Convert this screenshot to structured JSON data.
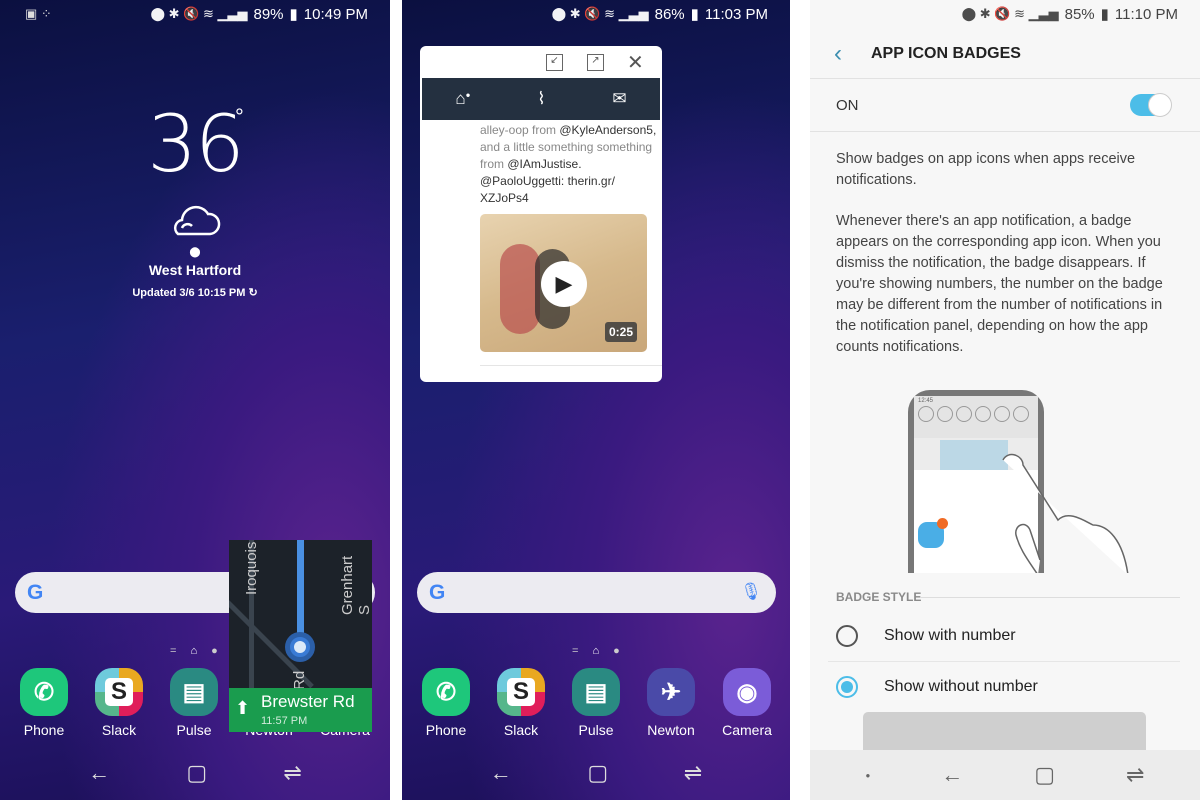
{
  "left": {
    "status": {
      "battery": "89%",
      "time": "10:49 PM"
    },
    "weather": {
      "temp": "36",
      "degree": "°",
      "location": "West Hartford",
      "updated": "Updated 3/6 10:15 PM",
      "icon": "cloud-icon"
    },
    "map_widget": {
      "street_labels": [
        "Iroquois",
        "Grenhart S",
        "Rd",
        "d"
      ],
      "next_street": "Brewster Rd",
      "eta": "11:57 PM"
    },
    "dock": [
      {
        "label": "Phone",
        "color": "#1ec77b"
      },
      {
        "label": "Slack",
        "color": "#ffffff"
      },
      {
        "label": "Pulse",
        "color": "#2a8a82"
      },
      {
        "label": "Newton",
        "color": "#4a4aa8"
      },
      {
        "label": "Camera",
        "color": "#7b5cd8"
      }
    ]
  },
  "middle": {
    "status": {
      "battery": "86%",
      "time": "11:03 PM"
    },
    "popup": {
      "tweet_lines": [
        {
          "gray": "alley-oop from ",
          "dark": "@KyleAnderson5,"
        },
        {
          "gray": "and a little something something",
          "dark": ""
        },
        {
          "gray": "from ",
          "dark": "@IAmJustise."
        },
        {
          "gray": "",
          "dark": "@PaoloUggetti: therin.gr/"
        },
        {
          "gray": "",
          "dark": "XZJoPs4"
        }
      ],
      "video_duration": "0:25"
    },
    "dock": [
      {
        "label": "Phone",
        "color": "#1ec77b"
      },
      {
        "label": "Slack",
        "color": "#ffffff"
      },
      {
        "label": "Pulse",
        "color": "#2a8a82"
      },
      {
        "label": "Newton",
        "color": "#4a4aa8"
      },
      {
        "label": "Camera",
        "color": "#7b5cd8"
      }
    ]
  },
  "right": {
    "status": {
      "battery": "85%",
      "time": "11:10 PM"
    },
    "title": "APP ICON BADGES",
    "toggle": {
      "label": "ON",
      "on": true,
      "accent": "#4cbde8"
    },
    "desc1": "Show badges on app icons when apps receive notifications.",
    "desc2": "Whenever there's an app notification, a badge appears on the corresponding app icon. When you dismiss the notification, the badge disappears. If you're showing numbers, the number on the badge may be different from the number of notifications in the notification panel, depending on how the app counts notifications.",
    "illustration_time": "12:45",
    "section": "BADGE STYLE",
    "options": [
      {
        "label": "Show with number",
        "selected": false
      },
      {
        "label": "Show without number",
        "selected": true
      }
    ]
  }
}
